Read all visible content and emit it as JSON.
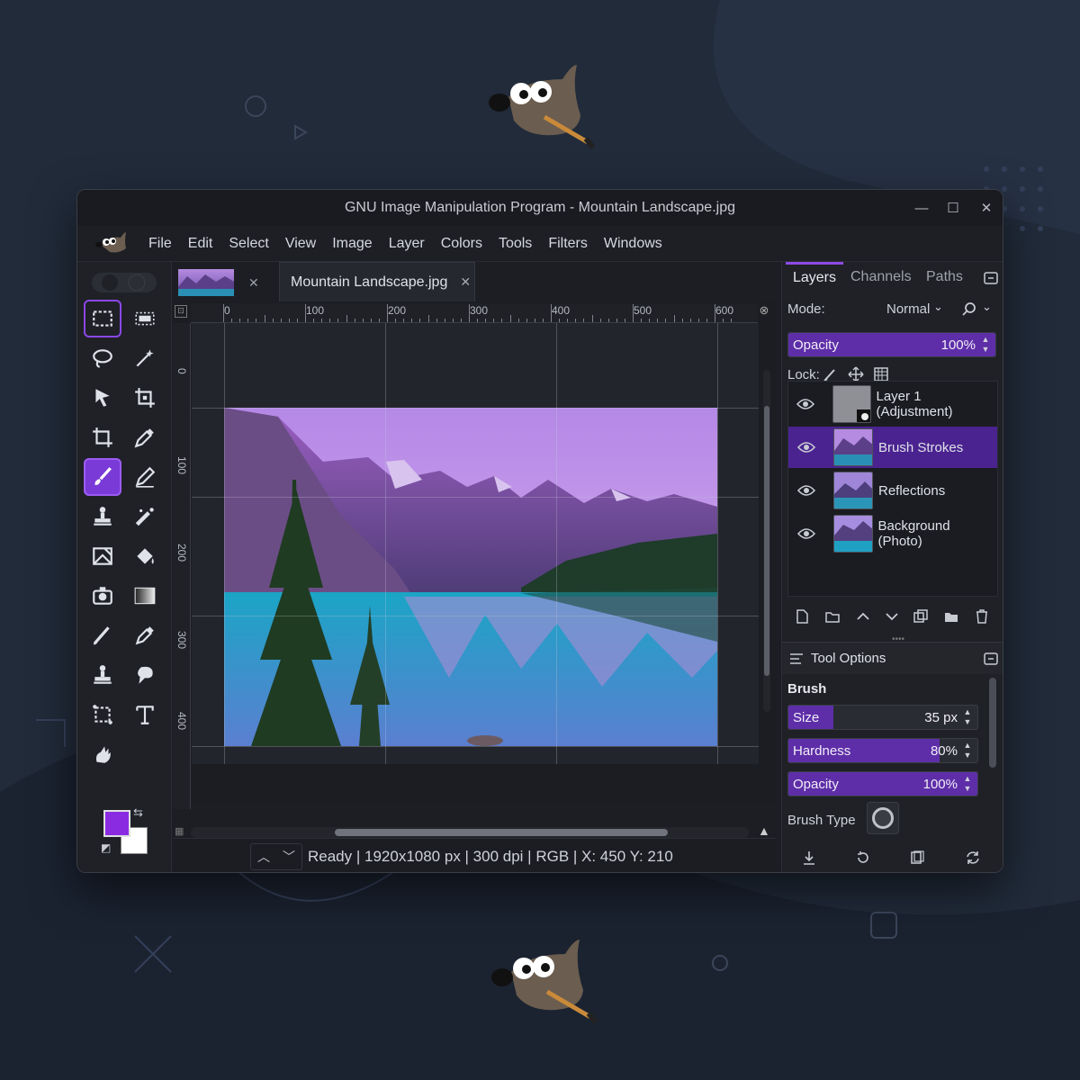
{
  "window": {
    "title": "GNU Image Manipulation Program - Mountain Landscape.jpg"
  },
  "window_controls": {
    "minimize": "—",
    "maximize": "☐",
    "close": "✕"
  },
  "menu": [
    "File",
    "Edit",
    "Select",
    "View",
    "Image",
    "Layer",
    "Colors",
    "Tools",
    "Filters",
    "Windows"
  ],
  "tabs": {
    "document": "Mountain Landscape.jpg",
    "close_symbol": "✕"
  },
  "ruler": {
    "top_labels": [
      "0",
      "100",
      "200",
      "300",
      "400",
      "500",
      "600"
    ],
    "left_labels": [
      "0",
      "100",
      "200",
      "300",
      "400"
    ]
  },
  "status": {
    "text": "Ready | 1920x1080 px | 300 dpi | RGB | X: 450 Y: 210"
  },
  "panel_tabs": [
    "Layers",
    "Channels",
    "Paths"
  ],
  "layers_panel": {
    "mode_label": "Mode:",
    "mode_value": "Normal",
    "opacity_label": "Opacity",
    "opacity_value": "100%",
    "opacity_fraction": 1.0,
    "lock_label": "Lock:",
    "layers": [
      {
        "name": "Layer 1 (Adjustment)",
        "selected": false
      },
      {
        "name": "Brush Strokes",
        "selected": true
      },
      {
        "name": "Reflections",
        "selected": false
      },
      {
        "name": "Background (Photo)",
        "selected": false
      }
    ]
  },
  "tool_options": {
    "title": "Tool Options",
    "brush_heading": "Brush",
    "size_label": "Size",
    "size_value": "35 px",
    "size_fraction": 0.24,
    "hardness_label": "Hardness",
    "hardness_value": "80%",
    "hardness_fraction": 0.8,
    "opacity_label": "Opacity",
    "opacity_value": "100%",
    "opacity_fraction": 1.0,
    "brush_type_label": "Brush Type"
  },
  "colors": {
    "accent": "#7a3ad8",
    "foreground": "#8a2be2",
    "background": "#ffffff",
    "window_bg": "#1c1e24",
    "page_bg": "#212b3a"
  },
  "icons": [
    "rect-select-icon",
    "ellipse-select-icon",
    "lasso-icon",
    "magic-wand-icon",
    "move-icon",
    "align-icon",
    "crop-icon",
    "color-picker-icon",
    "paintbrush-icon",
    "pencil-icon",
    "clone-icon",
    "heal-icon",
    "perspective-icon",
    "bucket-fill-icon",
    "camera-icon",
    "gradient-icon",
    "ink-icon",
    "eyedropper-icon",
    "stamp-icon",
    "smudge-icon",
    "transform-icon",
    "text-icon",
    "dodge-icon"
  ]
}
